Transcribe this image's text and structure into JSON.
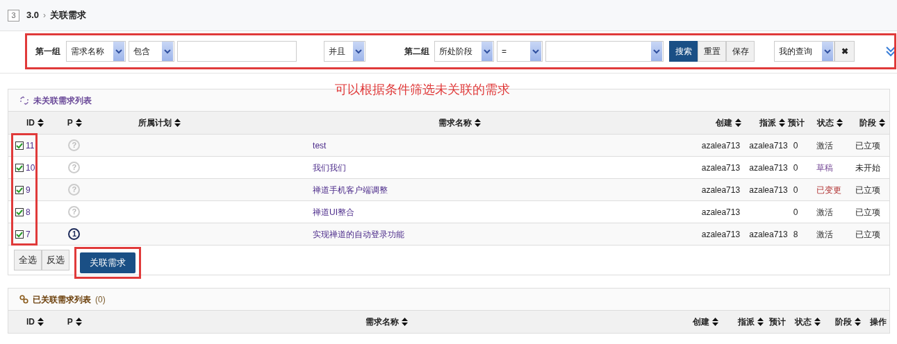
{
  "breadcrumb": {
    "badge": "3",
    "project": "3.0",
    "separator": "›",
    "page": "关联需求"
  },
  "filter": {
    "group1": {
      "label": "第一组",
      "field": "需求名称",
      "operator": "包含"
    },
    "join": "并且",
    "group2": {
      "label": "第二组",
      "field": "所处阶段",
      "operator": "="
    },
    "buttons": [
      {
        "label": "搜索",
        "primary": true
      },
      {
        "label": "重置",
        "primary": false
      },
      {
        "label": "保存",
        "primary": false
      }
    ],
    "saved_query": "我的查询",
    "clear": "✖"
  },
  "annotation": "可以根据条件筛选未关联的需求",
  "unlinked": {
    "title": "未关联需求列表",
    "columns": [
      "ID",
      "P",
      "所属计划",
      "需求名称",
      "创建",
      "指派",
      "预计",
      "状态",
      "阶段"
    ],
    "rows": [
      {
        "id": "11",
        "checked": true,
        "pri": {
          "label": "?",
          "set": false
        },
        "title": "test",
        "creator": "azalea713",
        "assignee": "azalea713",
        "estimate": "0",
        "status": "激活",
        "kind": "active",
        "stage": "已立项"
      },
      {
        "id": "10",
        "checked": true,
        "pri": {
          "label": "?",
          "set": false
        },
        "title": "我们我们",
        "creator": "azalea713",
        "assignee": "azalea713",
        "estimate": "0",
        "status": "草稿",
        "kind": "draft",
        "stage": "未开始"
      },
      {
        "id": "9",
        "checked": true,
        "pri": {
          "label": "?",
          "set": false
        },
        "title": "禅道手机客户端调整",
        "creator": "azalea713",
        "assignee": "azalea713",
        "estimate": "0",
        "status": "已变更",
        "kind": "changed",
        "stage": "已立项"
      },
      {
        "id": "8",
        "checked": true,
        "pri": {
          "label": "?",
          "set": false
        },
        "title": "禅道UI整合",
        "creator": "azalea713",
        "estimate": "0",
        "status": "激活",
        "kind": "active",
        "stage": "已立项"
      },
      {
        "id": "7",
        "checked": true,
        "pri": {
          "label": "1",
          "set": true
        },
        "title": "实现禅道的自动登录功能",
        "creator": "azalea713",
        "assignee": "azalea713",
        "estimate": "8",
        "status": "激活",
        "kind": "active",
        "stage": "已立项"
      }
    ],
    "actions": [
      "全选",
      "反选"
    ],
    "submit": "关联需求"
  },
  "linked": {
    "title": "已关联需求列表",
    "count": "(0)",
    "columns": [
      "ID",
      "P",
      "需求名称",
      "创建",
      "指派",
      "预计",
      "状态",
      "阶段",
      "操作"
    ],
    "sortable": [
      true,
      true,
      true,
      true,
      true,
      false,
      true,
      true,
      false
    ]
  }
}
